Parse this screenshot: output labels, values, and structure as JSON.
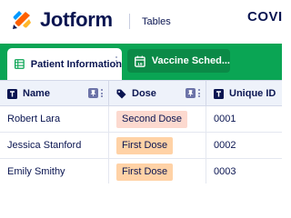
{
  "header": {
    "brand": "Jotform",
    "product": "Tables",
    "doc_title": "COVID"
  },
  "tabs": [
    {
      "label": "Patient Information",
      "icon": "table-grid-icon",
      "active": true
    },
    {
      "label": "Vaccine Sched...",
      "icon": "calendar-icon",
      "active": false
    }
  ],
  "table": {
    "columns": [
      {
        "label": "Name",
        "icon": "text-type-icon"
      },
      {
        "label": "Dose",
        "icon": "tag-icon"
      },
      {
        "label": "Unique ID",
        "icon": "text-type-icon"
      }
    ],
    "rows": [
      {
        "name": "Robert Lara",
        "dose": "Second Dose",
        "uid": "0001"
      },
      {
        "name": "Jessica Stanford",
        "dose": "First Dose",
        "uid": "0002"
      },
      {
        "name": "Emily Smithy",
        "dose": "First Dose",
        "uid": "0003"
      }
    ]
  },
  "colors": {
    "tabbar_green": "#0aa554",
    "inactive_tab_green": "#0b8a47",
    "second_dose_badge": "#fcd9cf",
    "first_dose_badge": "#ffd2a6",
    "brand_navy": "#0a1551"
  }
}
